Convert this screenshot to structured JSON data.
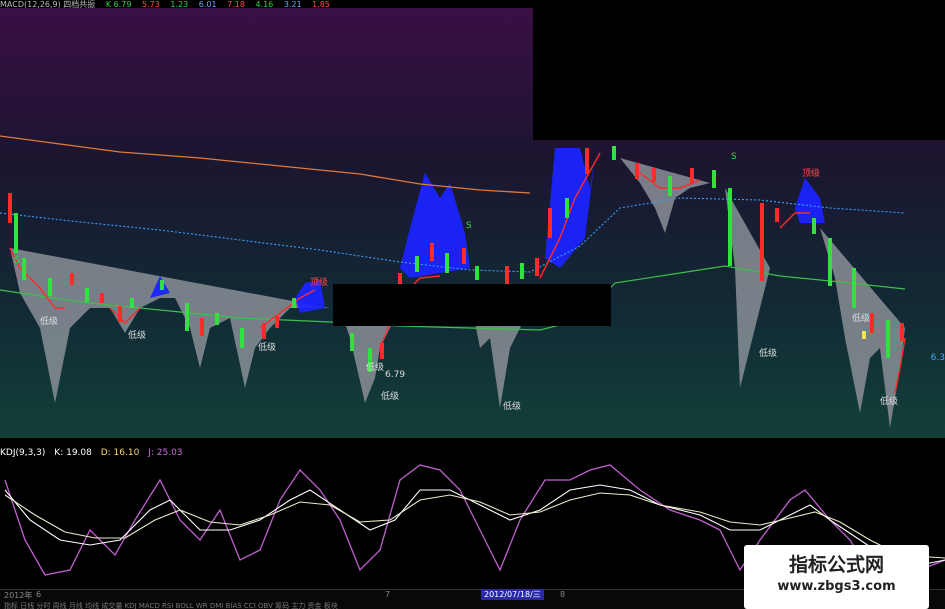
{
  "titlebar": {
    "title": "MACD(12,26,9) 四档共振",
    "k_value": "K 6.79",
    "segments": [
      "5.73",
      "1.23",
      "6.01",
      "7.18",
      "4.16",
      "3.21",
      "1.85"
    ]
  },
  "price_axis": {
    "label": "6.3"
  },
  "main_annotations": {
    "low_label": "低级",
    "high_label": "顶级",
    "sell_mark": "S",
    "price_tag": "6.79"
  },
  "kdj": {
    "name": "KDJ(9,3,3)",
    "k": "K: 19.08",
    "d": "D: 16.10",
    "j": "J: 25.03"
  },
  "date_axis": {
    "year": "2012年",
    "tick1": "6",
    "tick2": "7",
    "tick3": "8",
    "cursor_date": "2012/07/18/三",
    "menu": "指标  日线  分时  周线  月线  均线  成交量  KDJ  MACD  RSI  BOLL  WR  DMI  BIAS  CCI  OBV  筹码  主力  资金  板块"
  },
  "watermark": {
    "title": "指标公式网",
    "url": "www.zbgs3.com"
  },
  "colors": {
    "up": "#ff2a2a",
    "down": "#33e040",
    "ma_long": "#e07a3a",
    "ma_mid": "#3aa0ff",
    "ma_short": "#3cc04a",
    "band_fill": "#8a8f96",
    "kdj_j": "#c060d0",
    "kdj_k": "#ffffff"
  }
}
